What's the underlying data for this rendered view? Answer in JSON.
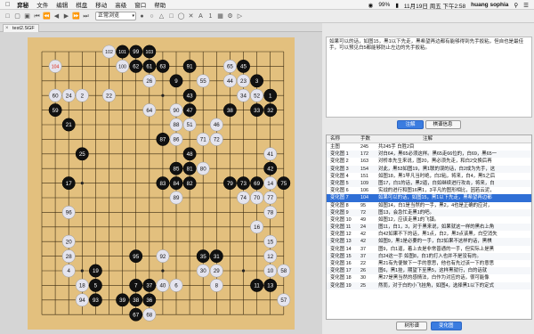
{
  "menubar": {
    "items": [
      "弈秘",
      "文件",
      "编辑",
      "棋盘",
      "移动",
      "高级",
      "窗口",
      "帮助"
    ],
    "battery": "99%",
    "datetime": "11月19日 周五 下午2:58",
    "user": "huang sophia"
  },
  "toolbar": {
    "mode": "正常浏览"
  },
  "tab": {
    "title": "test2.SGF"
  },
  "comment": {
    "text": "如果可以的话，如图15，黑1以下先走，黑希望再边都有能够得到先手扳粘，但自也是最佳手，可以预见白5都能够防止左边的先手扳粘。"
  },
  "buttons": {
    "comment": "注解",
    "variation_info": "棋谱信息",
    "tree_view": "树形谱",
    "variation_view": "变化图"
  },
  "variations": {
    "headers": {
      "name": "名称",
      "moves": "手数",
      "note": "注解"
    },
    "rows": [
      {
        "name": "主图",
        "moves": "245",
        "note": "共245手 白胜2目"
      },
      {
        "name": "变化图 1",
        "moves": "172",
        "note": "对白64，黑65必须这样。黑65走66位的，白69，黑65一"
      },
      {
        "name": "变化图 2",
        "moves": "163",
        "note": "对桥本先生来说，图20，黑必须先走，和白2交换后再"
      },
      {
        "name": "变化图 3",
        "moves": "154",
        "note": "对此，黑53如图19，黑1联的误的话，白2成为先手，这"
      },
      {
        "name": "变化图 4",
        "moves": "151",
        "note": "如图18，黑1早凡当时绝，白2粘，将来，白4，黑5之后"
      },
      {
        "name": "变化图 5",
        "moves": "109",
        "note": "图17，白1的话，黑2逼，白如继续进行攻击，将来，白"
      },
      {
        "name": "变化图 6",
        "moves": "106",
        "note": "实战的进行和图16黑1，3平凡的图形相比，因若云泥，"
      },
      {
        "name": "变化图 7",
        "moves": "104",
        "note": "如果可以的话，如图15，黑1以下先走，黑希望再边都"
      },
      {
        "name": "变化图 8",
        "moves": "95",
        "note": "如图14，白1是当然的一手，黑2，4也是正确的应对，"
      },
      {
        "name": "变化图 9",
        "moves": "72",
        "note": "图13，会急忙走黑1的吧。"
      },
      {
        "name": "变化图 10",
        "moves": "49",
        "note": "如图12，应该走黑1的飞镇。"
      },
      {
        "name": "变化图 11",
        "moves": "24",
        "note": "图11，白1，3，对于黑来说，如果就这一样的黑右上角"
      },
      {
        "name": "变化图 12",
        "moves": "42",
        "note": "白42如果不下的话，黑1点，白2，黑3点该黑，白空消失"
      },
      {
        "name": "变化图 13",
        "moves": "42",
        "note": "如图9，黑1是必要的一手，白2如果不这样的话，黑棋"
      },
      {
        "name": "变化图 14",
        "moves": "37",
        "note": "图9，白1逼，着上去是非常普通的一手，但实际上是黑"
      },
      {
        "name": "变化图 15",
        "moves": "37",
        "note": "白24这一手 如图8，白1的打入也并不是没有的。"
      },
      {
        "name": "变化图 16",
        "moves": "22",
        "note": "黑21有先便做下一手的意思，他也有先过该一下的意思"
      },
      {
        "name": "变化图 17",
        "moves": "26",
        "note": "图6，黑1挂，期望下至黑5，这样黑就行，白的话就"
      },
      {
        "name": "变化图 18",
        "moves": "30",
        "note": "黑27是黑当然的感情法，白作为对应的话，很可能像"
      },
      {
        "name": "变化图 19",
        "moves": "25",
        "note": "然而，对于白的小飞挂角，如图4，选择黑1以下的定式"
      }
    ]
  },
  "board_stones": [
    {
      "c": "w",
      "n": "102",
      "x": 5,
      "y": 0
    },
    {
      "c": "b",
      "n": "101",
      "x": 6,
      "y": 0
    },
    {
      "c": "b",
      "n": "99",
      "x": 7,
      "y": 0
    },
    {
      "c": "b",
      "n": "103",
      "x": 8,
      "y": 0
    },
    {
      "c": "w",
      "n": "104",
      "x": 1,
      "y": 1,
      "red": true
    },
    {
      "c": "w",
      "n": "100",
      "x": 6,
      "y": 1
    },
    {
      "c": "b",
      "n": "62",
      "x": 7,
      "y": 1
    },
    {
      "c": "b",
      "n": "61",
      "x": 8,
      "y": 1
    },
    {
      "c": "b",
      "n": "63",
      "x": 9,
      "y": 1
    },
    {
      "c": "b",
      "n": "91",
      "x": 11,
      "y": 1
    },
    {
      "c": "w",
      "n": "65",
      "x": 14,
      "y": 1
    },
    {
      "c": "b",
      "n": "45",
      "x": 15,
      "y": 1
    },
    {
      "c": "w",
      "n": "26",
      "x": 8,
      "y": 2
    },
    {
      "c": "b",
      "n": "9",
      "x": 10,
      "y": 2
    },
    {
      "c": "w",
      "n": "55",
      "x": 12,
      "y": 2
    },
    {
      "c": "w",
      "n": "44",
      "x": 14,
      "y": 2
    },
    {
      "c": "w",
      "n": "23",
      "x": 15,
      "y": 2
    },
    {
      "c": "b",
      "n": "3",
      "x": 16,
      "y": 2
    },
    {
      "c": "w",
      "n": "60",
      "x": 1,
      "y": 3
    },
    {
      "c": "w",
      "n": "24",
      "x": 2,
      "y": 3
    },
    {
      "c": "w",
      "n": "2",
      "x": 3,
      "y": 3
    },
    {
      "c": "w",
      "n": "22",
      "x": 5,
      "y": 3
    },
    {
      "c": "b",
      "n": "43",
      "x": 11,
      "y": 3
    },
    {
      "c": "w",
      "n": "34",
      "x": 15,
      "y": 3
    },
    {
      "c": "w",
      "n": "52",
      "x": 16,
      "y": 3
    },
    {
      "c": "b",
      "n": "1",
      "x": 17,
      "y": 3
    },
    {
      "c": "b",
      "n": "59",
      "x": 1,
      "y": 4
    },
    {
      "c": "w",
      "n": "64",
      "x": 8,
      "y": 4
    },
    {
      "c": "w",
      "n": "90",
      "x": 10,
      "y": 4
    },
    {
      "c": "b",
      "n": "47",
      "x": 11,
      "y": 4
    },
    {
      "c": "b",
      "n": "38",
      "x": 14,
      "y": 4
    },
    {
      "c": "b",
      "n": "33",
      "x": 16,
      "y": 4
    },
    {
      "c": "b",
      "n": "32",
      "x": 17,
      "y": 4
    },
    {
      "c": "b",
      "n": "21",
      "x": 2,
      "y": 5
    },
    {
      "c": "w",
      "n": "88",
      "x": 10,
      "y": 5
    },
    {
      "c": "w",
      "n": "51",
      "x": 11,
      "y": 5
    },
    {
      "c": "w",
      "n": "46",
      "x": 13,
      "y": 5
    },
    {
      "c": "b",
      "n": "87",
      "x": 9,
      "y": 6
    },
    {
      "c": "w",
      "n": "86",
      "x": 10,
      "y": 6
    },
    {
      "c": "w",
      "n": "71",
      "x": 12,
      "y": 6
    },
    {
      "c": "w",
      "n": "72",
      "x": 13,
      "y": 6
    },
    {
      "c": "b",
      "n": "25",
      "x": 3,
      "y": 7
    },
    {
      "c": "b",
      "n": "48",
      "x": 11,
      "y": 7
    },
    {
      "c": "w",
      "n": "41",
      "x": 17,
      "y": 7
    },
    {
      "c": "b",
      "n": "85",
      "x": 10,
      "y": 8
    },
    {
      "c": "b",
      "n": "81",
      "x": 11,
      "y": 8
    },
    {
      "c": "w",
      "n": "80",
      "x": 12,
      "y": 8
    },
    {
      "c": "b",
      "n": "42",
      "x": 17,
      "y": 8
    },
    {
      "c": "b",
      "n": "17",
      "x": 2,
      "y": 9
    },
    {
      "c": "b",
      "n": "83",
      "x": 9,
      "y": 9
    },
    {
      "c": "b",
      "n": "84",
      "x": 10,
      "y": 9
    },
    {
      "c": "b",
      "n": "82",
      "x": 11,
      "y": 9
    },
    {
      "c": "b",
      "n": "79",
      "x": 14,
      "y": 9
    },
    {
      "c": "b",
      "n": "73",
      "x": 15,
      "y": 9
    },
    {
      "c": "b",
      "n": "69",
      "x": 16,
      "y": 9
    },
    {
      "c": "w",
      "n": "14",
      "x": 17,
      "y": 9
    },
    {
      "c": "b",
      "n": "75",
      "x": 18,
      "y": 9
    },
    {
      "c": "w",
      "n": "89",
      "x": 10,
      "y": 10
    },
    {
      "c": "w",
      "n": "74",
      "x": 15,
      "y": 10
    },
    {
      "c": "w",
      "n": "70",
      "x": 16,
      "y": 10
    },
    {
      "c": "w",
      "n": "77",
      "x": 17,
      "y": 10
    },
    {
      "c": "w",
      "n": "96",
      "x": 2,
      "y": 11
    },
    {
      "c": "w",
      "n": "78",
      "x": 17,
      "y": 11
    },
    {
      "c": "w",
      "n": "16",
      "x": 16,
      "y": 12
    },
    {
      "c": "w",
      "n": "20",
      "x": 2,
      "y": 13
    },
    {
      "c": "w",
      "n": "15",
      "x": 17,
      "y": 13
    },
    {
      "c": "w",
      "n": "28",
      "x": 2,
      "y": 14
    },
    {
      "c": "b",
      "n": "95",
      "x": 7,
      "y": 14
    },
    {
      "c": "w",
      "n": "92",
      "x": 9,
      "y": 14
    },
    {
      "c": "b",
      "n": "35",
      "x": 12,
      "y": 14
    },
    {
      "c": "b",
      "n": "31",
      "x": 13,
      "y": 14
    },
    {
      "c": "w",
      "n": "12",
      "x": 17,
      "y": 14
    },
    {
      "c": "w",
      "n": "4",
      "x": 2,
      "y": 15
    },
    {
      "c": "b",
      "n": "19",
      "x": 4,
      "y": 15
    },
    {
      "c": "w",
      "n": "30",
      "x": 12,
      "y": 15
    },
    {
      "c": "w",
      "n": "29",
      "x": 13,
      "y": 15
    },
    {
      "c": "w",
      "n": "10",
      "x": 17,
      "y": 15
    },
    {
      "c": "w",
      "n": "58",
      "x": 18,
      "y": 15
    },
    {
      "c": "w",
      "n": "18",
      "x": 3,
      "y": 16
    },
    {
      "c": "b",
      "n": "5",
      "x": 4,
      "y": 16
    },
    {
      "c": "b",
      "n": "7",
      "x": 7,
      "y": 16
    },
    {
      "c": "b",
      "n": "37",
      "x": 8,
      "y": 16
    },
    {
      "c": "w",
      "n": "40",
      "x": 9,
      "y": 16
    },
    {
      "c": "w",
      "n": "6",
      "x": 10,
      "y": 16
    },
    {
      "c": "w",
      "n": "8",
      "x": 13,
      "y": 16
    },
    {
      "c": "b",
      "n": "11",
      "x": 16,
      "y": 16
    },
    {
      "c": "b",
      "n": "13",
      "x": 17,
      "y": 16
    },
    {
      "c": "w",
      "n": "94",
      "x": 3,
      "y": 17
    },
    {
      "c": "b",
      "n": "93",
      "x": 4,
      "y": 17
    },
    {
      "c": "b",
      "n": "39",
      "x": 6,
      "y": 17
    },
    {
      "c": "b",
      "n": "38",
      "x": 7,
      "y": 17
    },
    {
      "c": "b",
      "n": "36",
      "x": 8,
      "y": 17
    },
    {
      "c": "w",
      "n": "57",
      "x": 18,
      "y": 17
    },
    {
      "c": "b",
      "n": "67",
      "x": 7,
      "y": 18
    },
    {
      "c": "w",
      "n": "68",
      "x": 8,
      "y": 18
    }
  ]
}
